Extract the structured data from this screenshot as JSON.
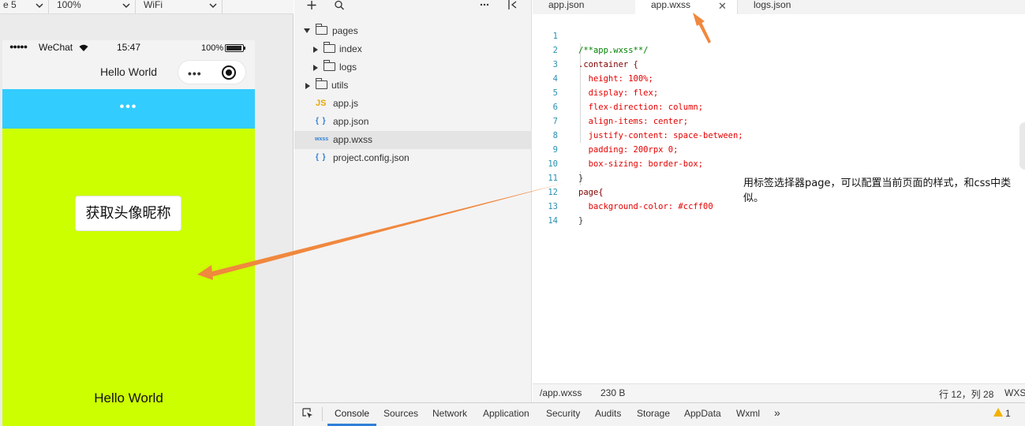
{
  "simulator": {
    "device": "e 5",
    "zoom": "100%",
    "network": "WiFi",
    "status_bar": {
      "signal": "●●●●●",
      "carrier": "WeChat",
      "time": "15:47",
      "battery": "100%"
    },
    "nav_title": "Hello World",
    "capsule_more": "•••",
    "loading_dots": "•••",
    "avatar_button": "获取头像昵称",
    "bottom_text": "Hello World",
    "page_background": "#ccff00",
    "band_color": "#33ccff"
  },
  "explorer": {
    "items": [
      {
        "label": "pages",
        "kind": "folder",
        "state": "expanded",
        "depth": 0
      },
      {
        "label": "index",
        "kind": "folder",
        "state": "collapsed",
        "depth": 1
      },
      {
        "label": "logs",
        "kind": "folder",
        "state": "collapsed",
        "depth": 1
      },
      {
        "label": "utils",
        "kind": "folder",
        "state": "collapsed",
        "depth": 0
      },
      {
        "label": "app.js",
        "kind": "js",
        "icon_text": "JS",
        "depth": 0
      },
      {
        "label": "app.json",
        "kind": "json",
        "icon_text": "{ }",
        "depth": 0
      },
      {
        "label": "app.wxss",
        "kind": "wxss",
        "icon_text": "wxss",
        "depth": 0,
        "selected": true
      },
      {
        "label": "project.config.json",
        "kind": "json",
        "icon_text": "{ }",
        "depth": 0
      }
    ]
  },
  "editor": {
    "tabs": [
      {
        "label": "app.json"
      },
      {
        "label": "app.wxss",
        "active": true
      },
      {
        "label": "logs.json"
      }
    ],
    "tab_close": "✕",
    "lines": [
      {
        "n": "1",
        "text": "/**app.wxss**/"
      },
      {
        "n": "2",
        "text": ".container {"
      },
      {
        "n": "3",
        "text": "  height: 100%;"
      },
      {
        "n": "4",
        "text": "  display: flex;"
      },
      {
        "n": "5",
        "text": "  flex-direction: column;"
      },
      {
        "n": "6",
        "text": "  align-items: center;"
      },
      {
        "n": "7",
        "text": "  justify-content: space-between;"
      },
      {
        "n": "8",
        "text": "  padding: 200rpx 0;"
      },
      {
        "n": "9",
        "text": "  box-sizing: border-box;"
      },
      {
        "n": "10",
        "text": "}"
      },
      {
        "n": "11",
        "text": "page{"
      },
      {
        "n": "12",
        "text": "  background-color: #ccff00"
      },
      {
        "n": "13",
        "text": "}"
      },
      {
        "n": "14",
        "text": ""
      }
    ],
    "annotation": "用标签选择器page，可以配置当前页面的样式，和css中类似。",
    "status": {
      "path": "/app.wxss",
      "size": "230 B",
      "position": "行 12，列 28",
      "language": "WXS"
    }
  },
  "devtools": {
    "tabs": [
      "Console",
      "Sources",
      "Network",
      "Application",
      "Security",
      "Audits",
      "Storage",
      "AppData",
      "Wxml"
    ],
    "active_tab": "Console",
    "more": "»",
    "warnings": "1"
  },
  "colors": {
    "arrow": "#f0883e",
    "accent": "#2f7fd6"
  }
}
